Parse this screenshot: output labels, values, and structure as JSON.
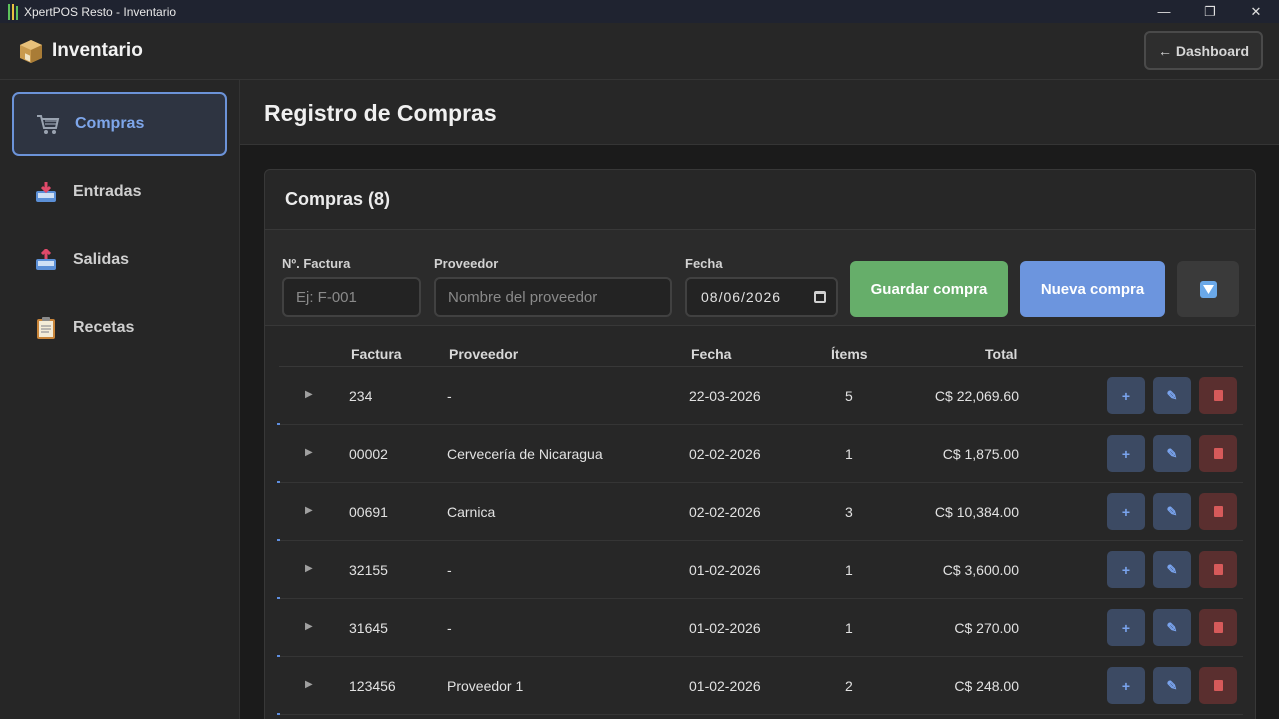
{
  "window": {
    "title": "XpertPOS Resto - Inventario",
    "controls": {
      "minimize": "—",
      "restore": "❐",
      "close": "✕"
    }
  },
  "header": {
    "title": "Inventario",
    "dashboard_button": "← Dashboard"
  },
  "sidebar": {
    "items": [
      {
        "label": "Compras",
        "icon": "cart-icon",
        "active": true
      },
      {
        "label": "Entradas",
        "icon": "inbox-in-icon",
        "active": false
      },
      {
        "label": "Salidas",
        "icon": "inbox-out-icon",
        "active": false
      },
      {
        "label": "Recetas",
        "icon": "clipboard-icon",
        "active": false
      }
    ]
  },
  "main": {
    "page_title": "Registro de Compras",
    "card_title": "Compras (8)",
    "form": {
      "invoice_label": "Nº. Factura",
      "invoice_placeholder": "Ej: F-001",
      "supplier_label": "Proveedor",
      "supplier_placeholder": "Nombre del proveedor",
      "date_label": "Fecha",
      "date_value": "08/06/2026",
      "save_button": "Guardar compra",
      "new_button": "Nueva compra"
    },
    "table": {
      "columns": [
        "Factura",
        "Proveedor",
        "Fecha",
        "Ítems",
        "Total"
      ],
      "rows": [
        {
          "factura": "234",
          "proveedor": "-",
          "fecha": "22-03-2026",
          "items": "5",
          "total": "C$ 22,069.60"
        },
        {
          "factura": "00002",
          "proveedor": "Cervecería de Nicaragua",
          "fecha": "02-02-2026",
          "items": "1",
          "total": "C$ 1,875.00"
        },
        {
          "factura": "00691",
          "proveedor": "Carnica",
          "fecha": "02-02-2026",
          "items": "3",
          "total": "C$ 10,384.00"
        },
        {
          "factura": "32155",
          "proveedor": "-",
          "fecha": "01-02-2026",
          "items": "1",
          "total": "C$ 3,600.00"
        },
        {
          "factura": "31645",
          "proveedor": "-",
          "fecha": "01-02-2026",
          "items": "1",
          "total": "C$ 270.00"
        },
        {
          "factura": "123456",
          "proveedor": "Proveedor 1",
          "fecha": "01-02-2026",
          "items": "2",
          "total": "C$ 248.00"
        }
      ],
      "row_actions": {
        "add": "+",
        "edit": "✎",
        "delete": "🗑"
      },
      "expand_glyph": "▶"
    }
  },
  "colors": {
    "accent_blue": "#6c95de",
    "save_green": "#66ae6a",
    "delete_red": "#d65a5a",
    "active_nav": "#7ea6ea"
  }
}
